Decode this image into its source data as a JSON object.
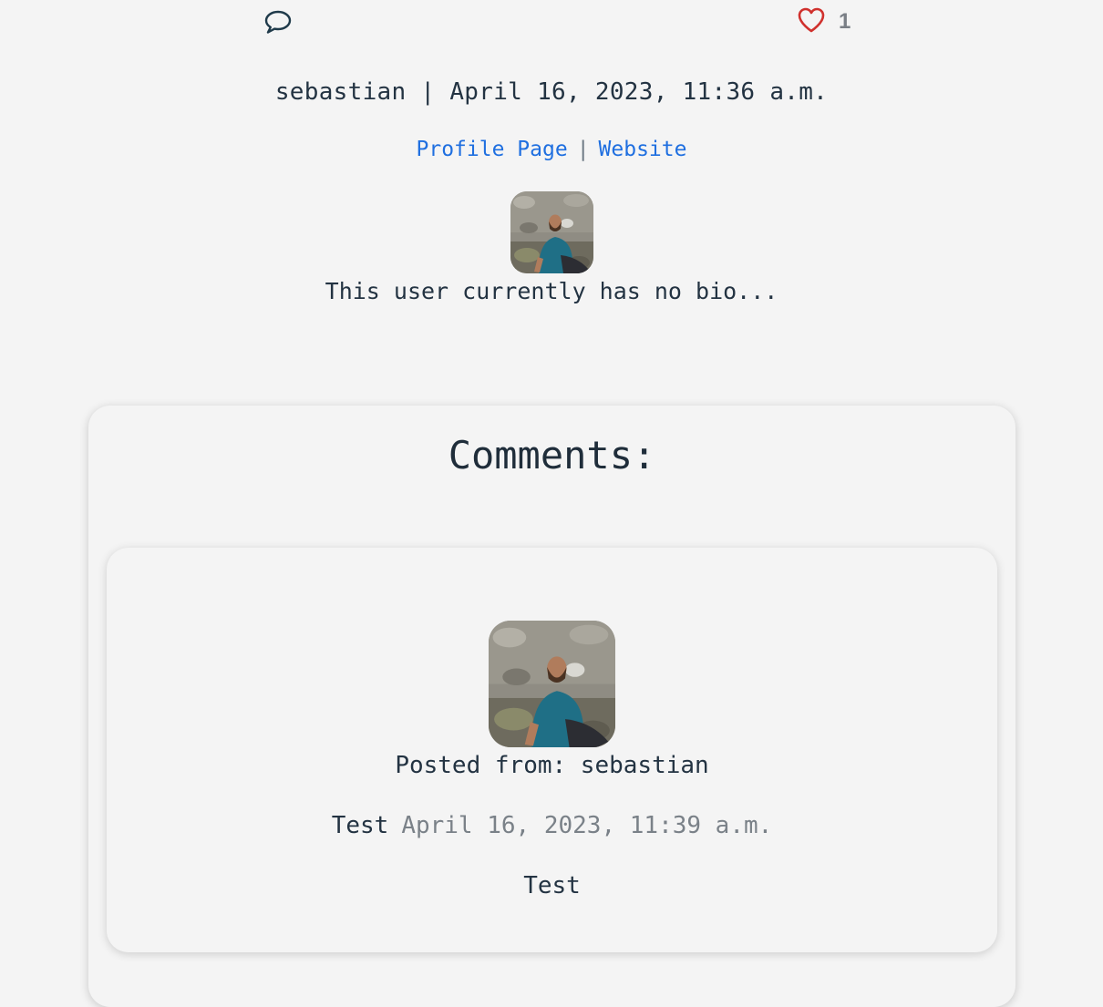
{
  "post": {
    "comment_icon": "speech-bubble-icon",
    "like_icon": "heart-outline-icon",
    "like_count": "1",
    "author": "sebastian",
    "separator": "|",
    "date": "April 16, 2023, 11:36 a.m."
  },
  "author_links": {
    "profile_label": "Profile Page",
    "separator": "|",
    "website_label": "Website"
  },
  "author_bio": "This user currently has no bio...",
  "comments": {
    "heading": "Comments:",
    "items": [
      {
        "posted_from": "Posted from: sebastian",
        "title": "Test",
        "date": "April 16, 2023, 11:39 a.m.",
        "body": "Test"
      }
    ]
  },
  "colors": {
    "background": "#f4f4f4",
    "text": "#233342",
    "link": "#1f6fe0",
    "heart": "#d0312d",
    "muted": "#7a8188",
    "comment_icon": "#1f3a4a"
  }
}
